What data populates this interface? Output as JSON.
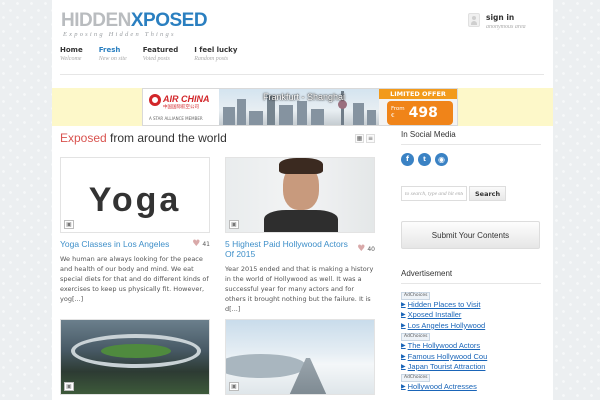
{
  "header": {
    "logo": {
      "part1": "HIDDEN",
      "part2": "XPOSED",
      "tagline": "Exposing Hidden Things"
    },
    "signin": {
      "title": "sign in",
      "subtitle": "anonymous area"
    }
  },
  "nav": [
    {
      "label": "Home",
      "sub": "Welcome"
    },
    {
      "label": "Fresh",
      "sub": "New on site"
    },
    {
      "label": "Featured",
      "sub": "Voted posts"
    },
    {
      "label": "I feel lucky",
      "sub": "Random posts"
    }
  ],
  "banner": {
    "brand": "AIR CHINA",
    "brand_cn": "中国国际航空公司",
    "member": "A STAR ALLIANCE MEMBER",
    "route": "Frankfurt - Shanghai",
    "badge": "LIMITED OFFER",
    "from": "From",
    "currency": "€",
    "price": "498"
  },
  "main": {
    "title_highlight": "Exposed",
    "title_rest": " from around the world",
    "posts": [
      {
        "title": "Yoga Classes in Los Angeles",
        "likes": "41",
        "image_text": "Yoga",
        "excerpt": "We human are always looking for the peace and health of our body and mind. We eat special diets for that and do different kinds of exercises to keep us physically fit. However, yog[...]"
      },
      {
        "title": "5 Highest Paid Hollywood Actors Of 2015",
        "likes": "40",
        "excerpt": "Year 2015 ended and that is making a history in the world of Hollywood as well. It was a successful year for many actors and for others it brought nothing but the failure. It is d[...]"
      },
      {
        "title": "",
        "likes": ""
      },
      {
        "title": "",
        "likes": ""
      }
    ]
  },
  "sidebar": {
    "social_title": "In Social Media",
    "social": [
      "f",
      "t",
      "rss"
    ],
    "search_placeholder": "to search, type and hit enter",
    "search_button": "Search",
    "submit_button": "Submit Your Contents",
    "ad_title": "Advertisement",
    "adchoices": "AdChoices",
    "ad_links": [
      "Hidden Places to Visit",
      "Xposed Installer",
      "Los Angeles Hollywood",
      "The Hollywood Actors",
      "Famous Hollywood Cou",
      "Japan Tourist Attraction",
      "Hollywood Actresses"
    ]
  },
  "colors": {
    "accent": "#2a7fc0",
    "highlight": "#d9534f",
    "link": "#3e8fc9",
    "banner_bg": "#fdf8c9"
  }
}
